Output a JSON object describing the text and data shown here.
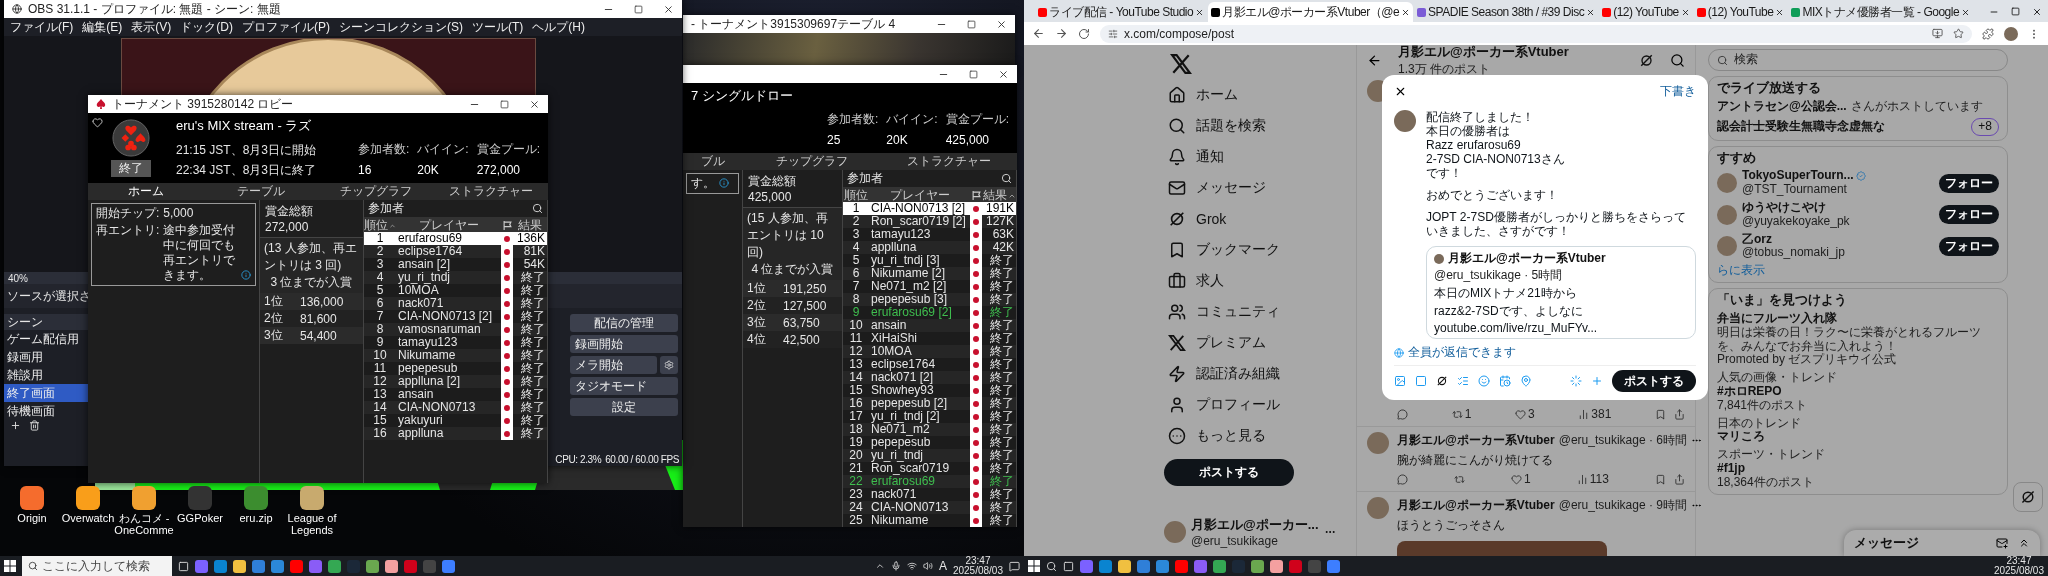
{
  "obs": {
    "title": "OBS 31.1.1 - プロファイル: 無題 - シーン: 無題",
    "menu": [
      "ファイル(F)",
      "編集(E)",
      "表示(V)",
      "ドック(D)",
      "プロファイル(P)",
      "シーンコレクション(S)",
      "ツール(T)",
      "ヘルプ(H)"
    ],
    "zoom": "40%",
    "sources_label": "ソースが選択さ",
    "scenes_title": "シーン",
    "scenes": [
      {
        "name": "ゲーム配信用",
        "selected": false
      },
      {
        "name": "録画用",
        "selected": false
      },
      {
        "name": "雑談用",
        "selected": false
      },
      {
        "name": "終了画面",
        "selected": true
      },
      {
        "name": "待機画面",
        "selected": false
      }
    ],
    "controls": [
      {
        "label": "配信の管理",
        "kind": "button"
      },
      {
        "label": "録画開始",
        "kind": "button"
      },
      {
        "label": "メラ開始",
        "kind": "gear"
      },
      {
        "label": "タジオモード",
        "kind": "button"
      },
      {
        "label": "設定",
        "kind": "button"
      }
    ],
    "status": [
      "CPU: 2.3%",
      "60.00 / 60.00 FPS"
    ]
  },
  "table_window": {
    "title": "- トーナメント3915309697テーブル 4"
  },
  "lobbies": [
    {
      "title": "トーナメント 3915280142 ロビー",
      "name": "eru's MIX stream - ラズ",
      "times": [
        "21:15 JST、8月3日に開始",
        "22:34 JST、8月3日に終了"
      ],
      "badge": "終了",
      "stats": [
        {
          "label": "参加者数:",
          "value": "16"
        },
        {
          "label": "バイイン:",
          "value": "20K"
        },
        {
          "label": "賞金プール:",
          "value": "272,000"
        }
      ],
      "tabs": [
        {
          "label": "ホーム",
          "selected": true
        },
        {
          "label": "テーブル",
          "selected": false
        },
        {
          "label": "チップグラフ",
          "selected": false
        },
        {
          "label": "ストラクチャー",
          "selected": false
        }
      ],
      "info": [
        {
          "label": "開始チップ:",
          "value": "5,000",
          "info_icon": false
        },
        {
          "label": "再エントリ:",
          "value": "途中参加受付中に何回でも再エントリできます。",
          "info_icon": true
        }
      ],
      "prize": {
        "label": "賞金総額",
        "total": "272,000",
        "note": "(13 人参加、再エントリは 3 回)",
        "note2": "3 位までが入賞",
        "places": [
          {
            "place": "1位",
            "amount": "136,000"
          },
          {
            "place": "2位",
            "amount": "81,600"
          },
          {
            "place": "3位",
            "amount": "54,400"
          }
        ]
      },
      "participants": {
        "title": "参加者",
        "columns": [
          {
            "kind": "text",
            "label": "順位",
            "sorted": true
          },
          {
            "kind": "text",
            "label": "プレイヤー",
            "sorted": false
          },
          {
            "kind": "flag",
            "sorted": false
          },
          {
            "kind": "text",
            "label": "結果",
            "sorted": false
          }
        ],
        "rows": [
          {
            "rank": "1",
            "player": "erufarosu69",
            "result": "136K",
            "selected": true,
            "highlighted": false
          },
          {
            "rank": "2",
            "player": "eclipse1764",
            "result": "81K",
            "selected": false,
            "highlighted": false
          },
          {
            "rank": "3",
            "player": "ansain [2]",
            "result": "54K",
            "selected": false,
            "highlighted": false
          },
          {
            "rank": "4",
            "player": "yu_ri_tndj",
            "result": "終了",
            "selected": false,
            "highlighted": false
          },
          {
            "rank": "5",
            "player": "10MOA",
            "result": "終了",
            "selected": false,
            "highlighted": false
          },
          {
            "rank": "6",
            "player": "nack071",
            "result": "終了",
            "selected": false,
            "highlighted": false
          },
          {
            "rank": "7",
            "player": "CIA-NON0713 [2]",
            "result": "終了",
            "selected": false,
            "highlighted": false
          },
          {
            "rank": "8",
            "player": "vamosnaruman",
            "result": "終了",
            "selected": false,
            "highlighted": false
          },
          {
            "rank": "9",
            "player": "tamayu123",
            "result": "終了",
            "selected": false,
            "highlighted": false
          },
          {
            "rank": "10",
            "player": "Nikumame",
            "result": "終了",
            "selected": false,
            "highlighted": false
          },
          {
            "rank": "11",
            "player": "pepepesub",
            "result": "終了",
            "selected": false,
            "highlighted": false
          },
          {
            "rank": "12",
            "player": "applluna [2]",
            "result": "終了",
            "selected": false,
            "highlighted": false
          },
          {
            "rank": "13",
            "player": "ansain",
            "result": "終了",
            "selected": false,
            "highlighted": false
          },
          {
            "rank": "14",
            "player": "CIA-NON0713",
            "result": "終了",
            "selected": false,
            "highlighted": false
          },
          {
            "rank": "15",
            "player": "yakuyuri",
            "result": "終了",
            "selected": false,
            "highlighted": false
          },
          {
            "rank": "16",
            "player": "applluna",
            "result": "終了",
            "selected": false,
            "highlighted": false
          }
        ]
      }
    },
    {
      "name": "7 シングルドロー",
      "stats": [
        {
          "label": "参加者数:",
          "value": "25"
        },
        {
          "label": "バイイン:",
          "value": "20K"
        },
        {
          "label": "賞金プール:",
          "value": "425,000"
        }
      ],
      "tabs": [
        {
          "label": "ブル",
          "selected": false
        },
        {
          "label": "チップグラフ",
          "selected": false
        },
        {
          "label": "ストラクチャー",
          "selected": false
        }
      ],
      "info": [
        {
          "value": "す。",
          "info_icon": true
        }
      ],
      "prize": {
        "label": "賞金総額",
        "total": "425,000",
        "note": "(15 人参加、再エントリは 10 回)",
        "note2": "4 位までが入賞",
        "places": [
          {
            "place": "1位",
            "amount": "191,250"
          },
          {
            "place": "2位",
            "amount": "127,500"
          },
          {
            "place": "3位",
            "amount": "63,750"
          },
          {
            "place": "4位",
            "amount": "42,500"
          }
        ]
      },
      "participants": {
        "title": "参加者",
        "columns": [
          {
            "kind": "text",
            "label": "順位",
            "sorted": false
          },
          {
            "kind": "text",
            "label": "プレイヤー",
            "sorted": false
          },
          {
            "kind": "flag",
            "sorted": false
          },
          {
            "kind": "text",
            "label": "結果",
            "sorted": true
          }
        ],
        "rows": [
          {
            "rank": "1",
            "player": "CIA-NON0713 [2]",
            "result": "191K",
            "selected": true,
            "highlighted": false
          },
          {
            "rank": "2",
            "player": "Ron_scar0719 [2]",
            "result": "127K",
            "selected": false,
            "highlighted": false
          },
          {
            "rank": "3",
            "player": "tamayu123",
            "result": "63K",
            "selected": false,
            "highlighted": false
          },
          {
            "rank": "4",
            "player": "applluna",
            "result": "42K",
            "selected": false,
            "highlighted": false
          },
          {
            "rank": "5",
            "player": "yu_ri_tndj [3]",
            "result": "終了",
            "selected": false,
            "highlighted": false
          },
          {
            "rank": "6",
            "player": "Nikumame [2]",
            "result": "終了",
            "selected": false,
            "highlighted": false
          },
          {
            "rank": "7",
            "player": "Ne071_m2 [2]",
            "result": "終了",
            "selected": false,
            "highlighted": false
          },
          {
            "rank": "8",
            "player": "pepepesub [3]",
            "result": "終了",
            "selected": false,
            "highlighted": false
          },
          {
            "rank": "9",
            "player": "erufarosu69 [2]",
            "result": "終了",
            "selected": false,
            "highlighted": true
          },
          {
            "rank": "10",
            "player": "ansain",
            "result": "終了",
            "selected": false,
            "highlighted": false
          },
          {
            "rank": "11",
            "player": "XiHaiShi",
            "result": "終了",
            "selected": false,
            "highlighted": false
          },
          {
            "rank": "12",
            "player": "10MOA",
            "result": "終了",
            "selected": false,
            "highlighted": false
          },
          {
            "rank": "13",
            "player": "eclipse1764",
            "result": "終了",
            "selected": false,
            "highlighted": false
          },
          {
            "rank": "14",
            "player": "nack071 [2]",
            "result": "終了",
            "selected": false,
            "highlighted": false
          },
          {
            "rank": "15",
            "player": "Showhey93",
            "result": "終了",
            "selected": false,
            "highlighted": false
          },
          {
            "rank": "16",
            "player": "pepepesub [2]",
            "result": "終了",
            "selected": false,
            "highlighted": false
          },
          {
            "rank": "17",
            "player": "yu_ri_tndj [2]",
            "result": "終了",
            "selected": false,
            "highlighted": false
          },
          {
            "rank": "18",
            "player": "Ne071_m2",
            "result": "終了",
            "selected": false,
            "highlighted": false
          },
          {
            "rank": "19",
            "player": "pepepesub",
            "result": "終了",
            "selected": false,
            "highlighted": false
          },
          {
            "rank": "20",
            "player": "yu_ri_tndj",
            "result": "終了",
            "selected": false,
            "highlighted": false
          },
          {
            "rank": "21",
            "player": "Ron_scar0719",
            "result": "終了",
            "selected": false,
            "highlighted": false
          },
          {
            "rank": "22",
            "player": "erufarosu69",
            "result": "終了",
            "selected": false,
            "highlighted": true
          },
          {
            "rank": "23",
            "player": "nack071",
            "result": "終了",
            "selected": false,
            "highlighted": false
          },
          {
            "rank": "24",
            "player": "CIA-NON0713",
            "result": "終了",
            "selected": false,
            "highlighted": false
          },
          {
            "rank": "25",
            "player": "Nikumame",
            "result": "終了",
            "selected": false,
            "highlighted": false
          }
        ]
      }
    }
  ],
  "desktop_icons": [
    {
      "label": "Origin",
      "color": "#f56c2d"
    },
    {
      "label": "Overwatch",
      "color": "#f99e1a"
    },
    {
      "label": "わんコメ - OneComme",
      "color": "#f0a030"
    },
    {
      "label": "GGPoker",
      "color": "#333333"
    },
    {
      "label": "eru.zip",
      "color": "#3c8d2f"
    },
    {
      "label": "League of Legends",
      "color": "#c8aa6e"
    }
  ],
  "taskbar_left": {
    "search_placeholder": "ここに入力して検索",
    "apps": [
      {
        "color": "#7b61ff"
      },
      {
        "color": "#0a84d0"
      },
      {
        "color": "#f0c040"
      },
      {
        "color": "#2f7fd8"
      },
      {
        "color": "#2b88d8"
      },
      {
        "color": "#ff0000"
      },
      {
        "color": "#8a5cf6"
      },
      {
        "color": "#34a853"
      },
      {
        "color": "#1b2838"
      },
      {
        "color": "#6aa84f"
      },
      {
        "color": "#f4a0a0"
      },
      {
        "color": "#d0021b"
      },
      {
        "color": "#444444"
      },
      {
        "color": "#3d7eff"
      }
    ],
    "ime": "A",
    "time": "23:47",
    "date": "2025/08/03"
  },
  "browser": {
    "tabs": [
      {
        "title": "ライブ配信 - YouTube Studio",
        "color": "#ff0000",
        "selected": false
      },
      {
        "title": "月影エル@ポーカー系Vtuber（@e",
        "color": "#000000",
        "selected": true
      },
      {
        "title": "SPADIE Season 38th / #39 Disc",
        "color": "#7b5cd6",
        "selected": false
      },
      {
        "title": "(12) YouTube",
        "color": "#ff0000",
        "selected": false
      },
      {
        "title": "(12) YouTube",
        "color": "#ff0000",
        "selected": false
      },
      {
        "title": "MIXトナメ優勝者一覧 - Google",
        "color": "#0f9d58",
        "selected": false
      }
    ],
    "address": "x.com/compose/post",
    "nav": [
      {
        "kind": "home",
        "label": "ホーム"
      },
      {
        "kind": "explore",
        "label": "話題を検索"
      },
      {
        "kind": "notifications",
        "label": "通知"
      },
      {
        "kind": "messages",
        "label": "メッセージ"
      },
      {
        "kind": "grok",
        "label": "Grok"
      },
      {
        "kind": "bookmarks",
        "label": "ブックマーク"
      },
      {
        "kind": "jobs",
        "label": "求人"
      },
      {
        "kind": "communities",
        "label": "コミュニティ"
      },
      {
        "kind": "premium",
        "label": "プレミアム"
      },
      {
        "kind": "orgs",
        "label": "認証済み組織"
      },
      {
        "kind": "profile",
        "label": "プロフィール"
      },
      {
        "kind": "more",
        "label": "もっと見る"
      }
    ],
    "post_button": "ポストする",
    "account": {
      "name": "月影エル@ポーカー...",
      "handle": "@eru_tsukikage"
    },
    "profile": {
      "name": "月影エル@ポーカー系Vtuber",
      "count": "1.3万 件のポスト"
    },
    "posts": [
      {
        "kind": "hidden",
        "reposts": "1",
        "likes": "3",
        "views": "381"
      },
      {
        "kind": "text",
        "name": "月影エル@ポーカー系Vtuber",
        "meta": "@eru_tsukikage · 6時間",
        "text": "腕が綺麗にこんがり焼けてる",
        "likes": "1",
        "views": "113"
      },
      {
        "kind": "photo",
        "name": "月影エル@ポーカー系Vtuber",
        "meta": "@eru_tsukikage · 9時間",
        "text": "ほうとうごっそさん"
      }
    ],
    "compose": {
      "draft": "下書き",
      "paragraphs": [
        [
          "配信終了しました！",
          "本日の優勝者は",
          "Razz erufarosu69",
          "2-7SD CIA-NON0713さん",
          "です！"
        ],
        [
          "おめでとうございます！"
        ],
        [
          "JOPT 2-7SD優勝者がしっかりと勝ちをさらっていきました、さすがです！"
        ]
      ],
      "quote": {
        "name": "月影エル@ポーカー系Vtuber",
        "meta": "@eru_tsukikage · 5時間",
        "lines": [
          "本日のMIXトナメ21時から",
          "razz&2-7SDです、よしなに",
          "youtube.com/live/rzu_MuFYv..."
        ]
      },
      "reply_setting": "全員が返信できます",
      "submit": "ポストする"
    },
    "search_placeholder": "検索",
    "spaces": {
      "title": "でライブ放送する",
      "host": "アントラセン@公認会...",
      "host_suffix": "さんがホストしています",
      "topic": "認会計士受験生無職寺念虚無な",
      "count": "+8"
    },
    "follow": {
      "title": "すすめ",
      "users": [
        {
          "name": "TokyoSuperTourn...",
          "handle": "@TST_Tournament",
          "verified": true,
          "button": "フォロー"
        },
        {
          "name": "ゆうやけこやけ",
          "handle": "@yuyakekoyake_pk",
          "verified": false,
          "button": "フォロー"
        },
        {
          "name": "乙orz",
          "handle": "@tobus_nomaki_jp",
          "verified": false,
          "button": "フォロー"
        }
      ],
      "more": "らに表示"
    },
    "trends": {
      "title": "「いま」を見つけよう",
      "items": [
        {
          "kind": "promoted",
          "name": "弁当にフルーツ入れ隊",
          "desc": "明日は栄養の日！ラク〜に栄養がとれるフルーツを、みんなでお弁当に入れよう！",
          "promoter": "Promoted by ゼスプリキウイ公式"
        },
        {
          "kind": "trend",
          "context": "人気の画像・トレンド",
          "name": "#ホロREPO",
          "count": "7,841件のポスト"
        },
        {
          "kind": "trend",
          "context": "日本のトレンド",
          "name": "マリころ"
        },
        {
          "kind": "trend",
          "context": "スポーツ・トレンド",
          "name": "#f1jp",
          "count": "18,364件のポスト"
        }
      ]
    },
    "messages": "メッセージ"
  },
  "taskbar_right": {
    "apps": [
      {
        "color": "#7b61ff"
      },
      {
        "color": "#0a84d0"
      },
      {
        "color": "#f0c040"
      },
      {
        "color": "#2f7fd8"
      },
      {
        "color": "#2b88d8"
      },
      {
        "color": "#ff0000"
      },
      {
        "color": "#8a5cf6"
      },
      {
        "color": "#34a853"
      },
      {
        "color": "#1b2838"
      },
      {
        "color": "#6aa84f"
      },
      {
        "color": "#f4a0a0"
      },
      {
        "color": "#d0021b"
      },
      {
        "color": "#444444"
      },
      {
        "color": "#3d7eff"
      }
    ],
    "time": "23:47",
    "date": "2025/08/03"
  }
}
